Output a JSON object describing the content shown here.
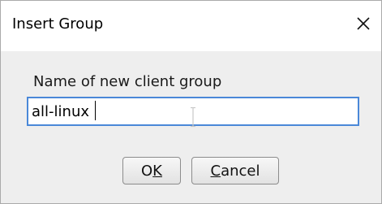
{
  "window": {
    "title": "Insert Group",
    "close_icon": "close-icon"
  },
  "form": {
    "prompt_label": "Name of new client group",
    "group_name_value": "all-linux"
  },
  "buttons": {
    "ok": {
      "mnemonic": "K",
      "prefix": "O",
      "suffix": ""
    },
    "cancel": {
      "mnemonic": "C",
      "prefix": "",
      "suffix": "ancel"
    }
  },
  "colors": {
    "focus_border": "#4a88d8",
    "body_background": "#eeeeee"
  }
}
